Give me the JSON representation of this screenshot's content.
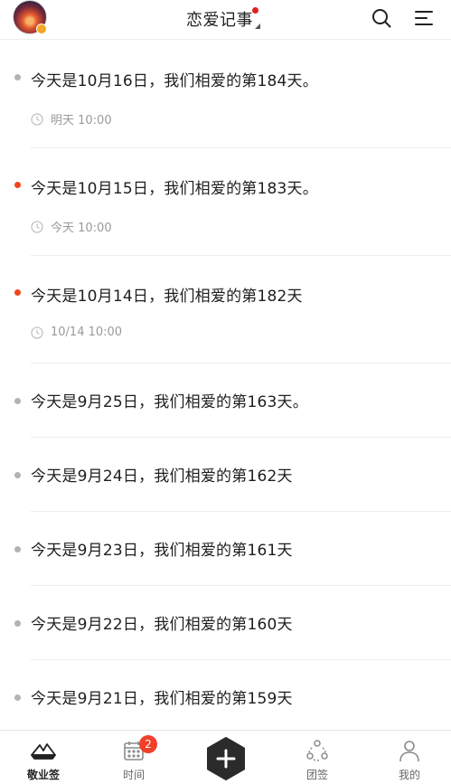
{
  "header": {
    "title": "恋爱记事"
  },
  "reminders": [
    {
      "text": "今天是10月16日，我们相爱的第184天。",
      "time": "明天 10:00",
      "dot_color": "#b3b3b3"
    },
    {
      "text": "今天是10月15日，我们相爱的第183天。",
      "time": "今天 10:00",
      "dot_color": "#f0461e"
    },
    {
      "text": "今天是10月14日，我们相爱的第182天",
      "time": "10/14 10:00",
      "dot_color": "#f0461e"
    },
    {
      "text": "今天是9月25日，我们相爱的第163天。",
      "dot_color": "#b3b3b3"
    },
    {
      "text": "今天是9月24日，我们相爱的第162天",
      "dot_color": "#b3b3b3"
    },
    {
      "text": "今天是9月23日，我们相爱的第161天",
      "dot_color": "#b3b3b3"
    },
    {
      "text": "今天是9月22日，我们相爱的第160天",
      "dot_color": "#b3b3b3"
    },
    {
      "text": "今天是9月21日，我们相爱的第159天",
      "dot_color": "#b3b3b3"
    }
  ],
  "tabbar": {
    "tabs": [
      {
        "label": "敬业签",
        "icon": "paper-boat-icon",
        "active": true
      },
      {
        "label": "时间",
        "icon": "calendar-icon",
        "badge": "2"
      },
      {
        "label": "",
        "icon": "add-icon"
      },
      {
        "label": "团签",
        "icon": "team-icon"
      },
      {
        "label": "我的",
        "icon": "profile-icon"
      }
    ]
  },
  "colors": {
    "accent_red": "#f0461e",
    "badge_red": "#f0402a",
    "muted": "#9a9a9a"
  }
}
